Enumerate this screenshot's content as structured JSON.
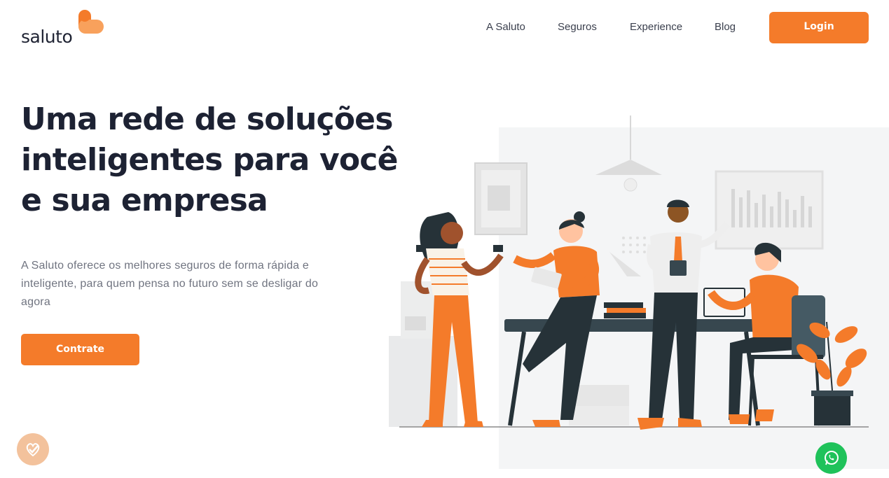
{
  "brand": {
    "name": "saluto",
    "accent": "#f47b2a",
    "text": "#1d2233"
  },
  "nav": {
    "items": [
      {
        "label": "A Saluto"
      },
      {
        "label": "Seguros"
      },
      {
        "label": "Experience"
      },
      {
        "label": "Blog"
      }
    ],
    "login_label": "Login"
  },
  "hero": {
    "headline_lines": [
      "Uma rede de soluções",
      "inteligentes para você",
      "e sua empresa"
    ],
    "description_lines": [
      "A Saluto oferece os melhores seguros de forma rápida e",
      "inteligente, para quem pensa no futuro sem se desligar do",
      "agora"
    ],
    "cta_label": "Contrate"
  },
  "illustration": {
    "subject": "office team meeting",
    "icon": "team-office-illustration"
  },
  "floating": {
    "badge_icon": "check-heart-icon",
    "whatsapp_icon": "whatsapp-icon",
    "whatsapp_color": "#1fc25a"
  }
}
